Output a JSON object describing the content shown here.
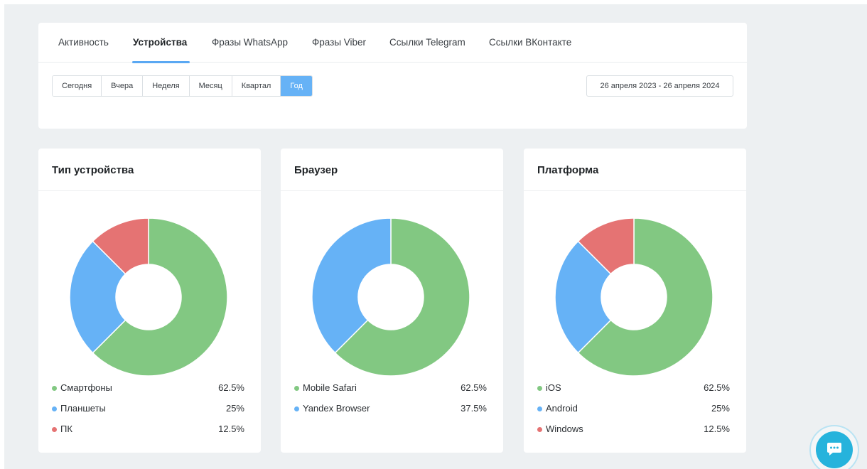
{
  "tabs": [
    {
      "label": "Активность",
      "active": false
    },
    {
      "label": "Устройства",
      "active": true
    },
    {
      "label": "Фразы WhatsApp",
      "active": false
    },
    {
      "label": "Фразы Viber",
      "active": false
    },
    {
      "label": "Ссылки Telegram",
      "active": false
    },
    {
      "label": "Ссылки ВКонтакте",
      "active": false
    }
  ],
  "periods": [
    {
      "label": "Сегодня",
      "active": false
    },
    {
      "label": "Вчера",
      "active": false
    },
    {
      "label": "Неделя",
      "active": false
    },
    {
      "label": "Месяц",
      "active": false
    },
    {
      "label": "Квартал",
      "active": false
    },
    {
      "label": "Год",
      "active": true
    }
  ],
  "date_range": "26 апреля 2023 - 26 апреля 2024",
  "colors": {
    "green": "#82c882",
    "blue": "#66b2f6",
    "red": "#e57373",
    "accent": "#66b2f6",
    "chat": "#26b3dc"
  },
  "cards": [
    {
      "title": "Тип устройства",
      "items": [
        {
          "label": "Смартфоны",
          "value": "62.5%",
          "pct": 62.5,
          "color": "#82c882"
        },
        {
          "label": "Планшеты",
          "value": "25%",
          "pct": 25,
          "color": "#66b2f6"
        },
        {
          "label": "ПК",
          "value": "12.5%",
          "pct": 12.5,
          "color": "#e57373"
        }
      ]
    },
    {
      "title": "Браузер",
      "items": [
        {
          "label": "Mobile Safari",
          "value": "62.5%",
          "pct": 62.5,
          "color": "#82c882"
        },
        {
          "label": "Yandex Browser",
          "value": "37.5%",
          "pct": 37.5,
          "color": "#66b2f6"
        }
      ]
    },
    {
      "title": "Платформа",
      "items": [
        {
          "label": "iOS",
          "value": "62.5%",
          "pct": 62.5,
          "color": "#82c882"
        },
        {
          "label": "Android",
          "value": "25%",
          "pct": 25,
          "color": "#66b2f6"
        },
        {
          "label": "Windows",
          "value": "12.5%",
          "pct": 12.5,
          "color": "#e57373"
        }
      ]
    }
  ],
  "chat_widget": {
    "icon": "chat-bubble-icon"
  }
}
